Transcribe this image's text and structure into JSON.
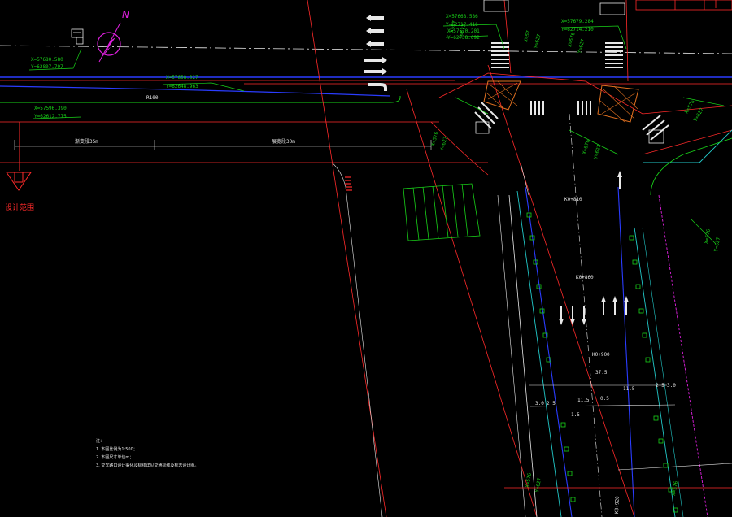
{
  "north_label": "N",
  "design_range_label": "设计范围",
  "coords": [
    {
      "x": "X=57680.580",
      "y": "Y=62807.797"
    },
    {
      "x": "X=57658.027",
      "y": "Y=62648.963"
    },
    {
      "x": "X=57596.390",
      "y": "Y=62612.775"
    },
    {
      "x": "X=57668.586",
      "y": "Y=62717.416"
    },
    {
      "x": "X=57670.201",
      "y": "Y=62738.692"
    },
    {
      "x": "X=57679.284",
      "y": "Y=62714.210"
    }
  ],
  "labels": {
    "r100": "R100",
    "seg_left": "渐变段35m",
    "seg_right": "展宽段30m",
    "k0_810": "K0+810",
    "k0_860": "K0+860",
    "k0_900": "K0+900",
    "k0_920": "K0+920",
    "width_total": "37.5",
    "dims": [
      "3.0",
      "2.5",
      "11.5",
      "0.5",
      "11.5",
      "2.5",
      "3.0"
    ],
    "dim_small": "1.5"
  },
  "notes": {
    "title": "注：",
    "items": [
      "1. 本图比例为1:500；",
      "2. 本图尺寸单位m；",
      "3. 交叉路口设计渠化及标线详见交通标线及标志设计图。"
    ]
  },
  "colors": {
    "red": "#ff2a2a",
    "green": "#19d219",
    "white": "#e8e8e8",
    "blue": "#2a3cff",
    "cyan": "#22c8c8",
    "magenta": "#e020e0",
    "orange": "#e07020"
  }
}
